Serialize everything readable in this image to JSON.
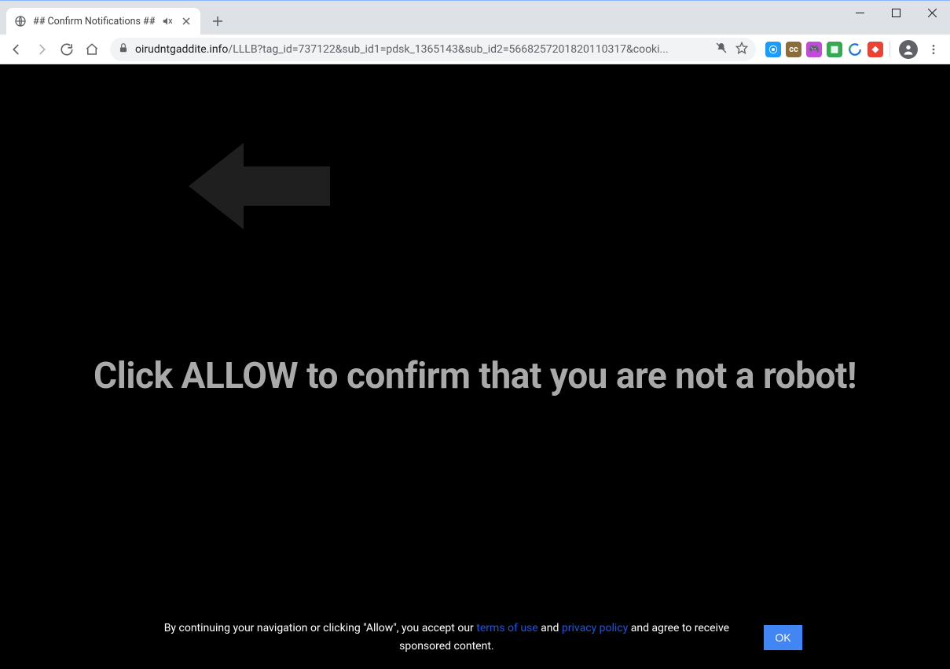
{
  "window": {
    "tab": {
      "title": "## Confirm Notifications ##",
      "favicon": "globe-icon",
      "audio_muted": true
    }
  },
  "toolbar": {
    "url_host": "oirudntgaddite.info",
    "url_path": "/LLLB?tag_id=737122&sub_id1=pdsk_1365143&sub_id2=5668257201820110317&cooki...",
    "extensions": [
      {
        "name": "ext-search",
        "bg": "#1a9cff",
        "glyph": "⦿"
      },
      {
        "name": "ext-cc",
        "bg": "#8a6d3b",
        "glyph": "cc"
      },
      {
        "name": "ext-game",
        "bg": "#c04cd9",
        "glyph": "🎮"
      },
      {
        "name": "ext-green",
        "bg": "#34a853",
        "glyph": "▦"
      },
      {
        "name": "ext-sync",
        "bg": "#ffffff",
        "glyph": ""
      },
      {
        "name": "ext-red",
        "bg": "#ea4335",
        "glyph": "◆"
      }
    ]
  },
  "page": {
    "headline": "Click ALLOW to confirm that you are not a robot!",
    "consent_prefix": "By continuing your navigation or clicking \"Allow\", you accept our ",
    "terms_label": "terms of use",
    "consent_mid": " and ",
    "privacy_label": "privacy policy",
    "consent_suffix": " and agree to receive sponsored content.",
    "ok_label": "OK"
  }
}
